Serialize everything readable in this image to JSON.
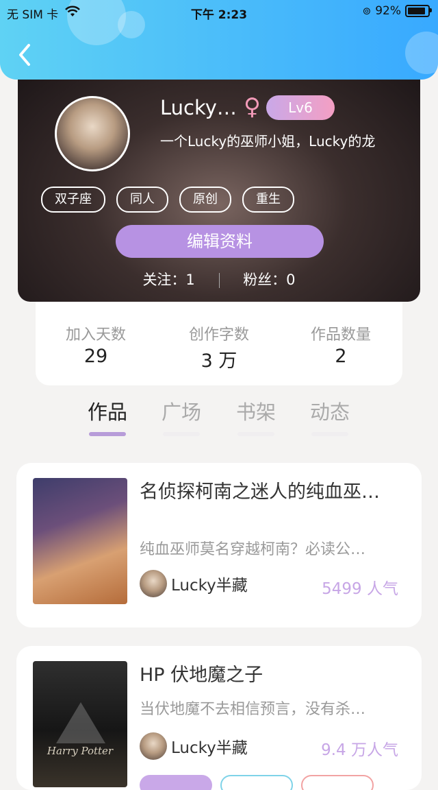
{
  "status_bar": {
    "carrier": "无 SIM 卡",
    "time": "下午 2:23",
    "battery": "92%"
  },
  "profile": {
    "name": "Lucky…",
    "gender_symbol": "♀",
    "level": "Lv6",
    "bio": "一个Lucky的巫师小姐，Lucky的龙",
    "tags": [
      "双子座",
      "同人",
      "原创",
      "重生"
    ],
    "edit_button": "编辑资料",
    "following": "关注：1",
    "followers": "粉丝：0"
  },
  "stats": [
    {
      "label": "加入天数",
      "value": "29"
    },
    {
      "label": "创作字数",
      "value": "3 万"
    },
    {
      "label": "作品数量",
      "value": "2"
    }
  ],
  "tabs": [
    "作品",
    "广场",
    "书架",
    "动态"
  ],
  "active_tab": "作品",
  "works": [
    {
      "title": "名侦探柯南之迷人的纯血巫…",
      "description": "纯血巫师莫名穿越柯南？必读公…",
      "author": "Lucky半藏",
      "popularity": "5499 人气"
    },
    {
      "title": "HP 伏地魔之子",
      "description": "当伏地魔不去相信预言，没有杀…",
      "author": "Lucky半藏",
      "popularity": "9.4 万人气",
      "cover_text": "Harry Potter"
    }
  ],
  "colors": {
    "header": "#38a9ff",
    "accent": "#b792e3",
    "popularity": "#c7a6e6"
  }
}
